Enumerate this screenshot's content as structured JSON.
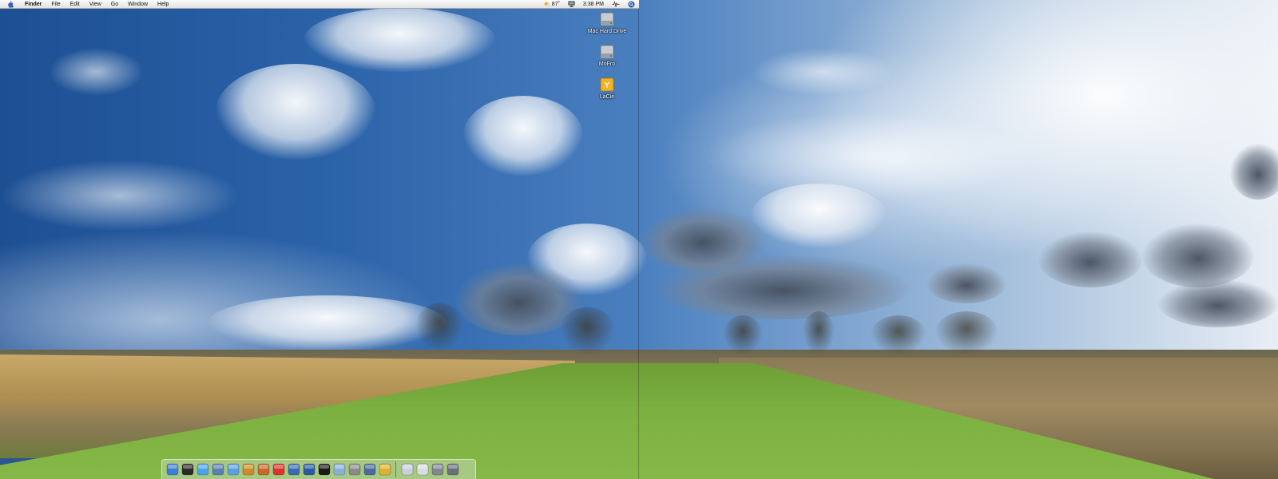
{
  "menubar": {
    "app_name": "Finder",
    "menus": [
      "File",
      "Edit",
      "View",
      "Go",
      "Window",
      "Help"
    ],
    "status": {
      "weather_temp": "87˚",
      "clock": "3:38 PM"
    }
  },
  "desktop_icons": [
    {
      "label": "Mac Hard Drive",
      "icon": "hard-drive-icon"
    },
    {
      "label": "MoFro",
      "icon": "hard-drive-icon"
    },
    {
      "label": "LaCie",
      "icon": "external-drive-icon"
    }
  ],
  "dock": {
    "apps": [
      {
        "name": "finder-icon",
        "color": "#3b7fd6"
      },
      {
        "name": "dashboard-icon",
        "color": "#2a2a2a"
      },
      {
        "name": "safari-icon",
        "color": "#4aa3e8"
      },
      {
        "name": "preview-icon",
        "color": "#5a7fb0"
      },
      {
        "name": "itunes-icon",
        "color": "#5aa0e0"
      },
      {
        "name": "iphoto-icon",
        "color": "#d08a2a"
      },
      {
        "name": "garageband-icon",
        "color": "#c86a2a"
      },
      {
        "name": "ical-icon",
        "color": "#e03030"
      },
      {
        "name": "address-book-icon",
        "color": "#3a6ab0"
      },
      {
        "name": "automator-icon",
        "color": "#2a5aa0"
      },
      {
        "name": "terminal-icon",
        "color": "#1a1a1a"
      },
      {
        "name": "textedit-icon",
        "color": "#8ab0d8"
      },
      {
        "name": "system-preferences-icon",
        "color": "#8a8a8a"
      },
      {
        "name": "script-editor-icon",
        "color": "#4a6aa0"
      },
      {
        "name": "photoshop-icon",
        "color": "#e0b030"
      }
    ],
    "docs": [
      {
        "name": "mail-icon",
        "color": "#c8d0d8"
      },
      {
        "name": "folder-icon",
        "color": "#d8dde2"
      },
      {
        "name": "photo-stack-icon",
        "color": "#808890"
      },
      {
        "name": "trash-icon",
        "color": "#6a7078"
      }
    ]
  }
}
